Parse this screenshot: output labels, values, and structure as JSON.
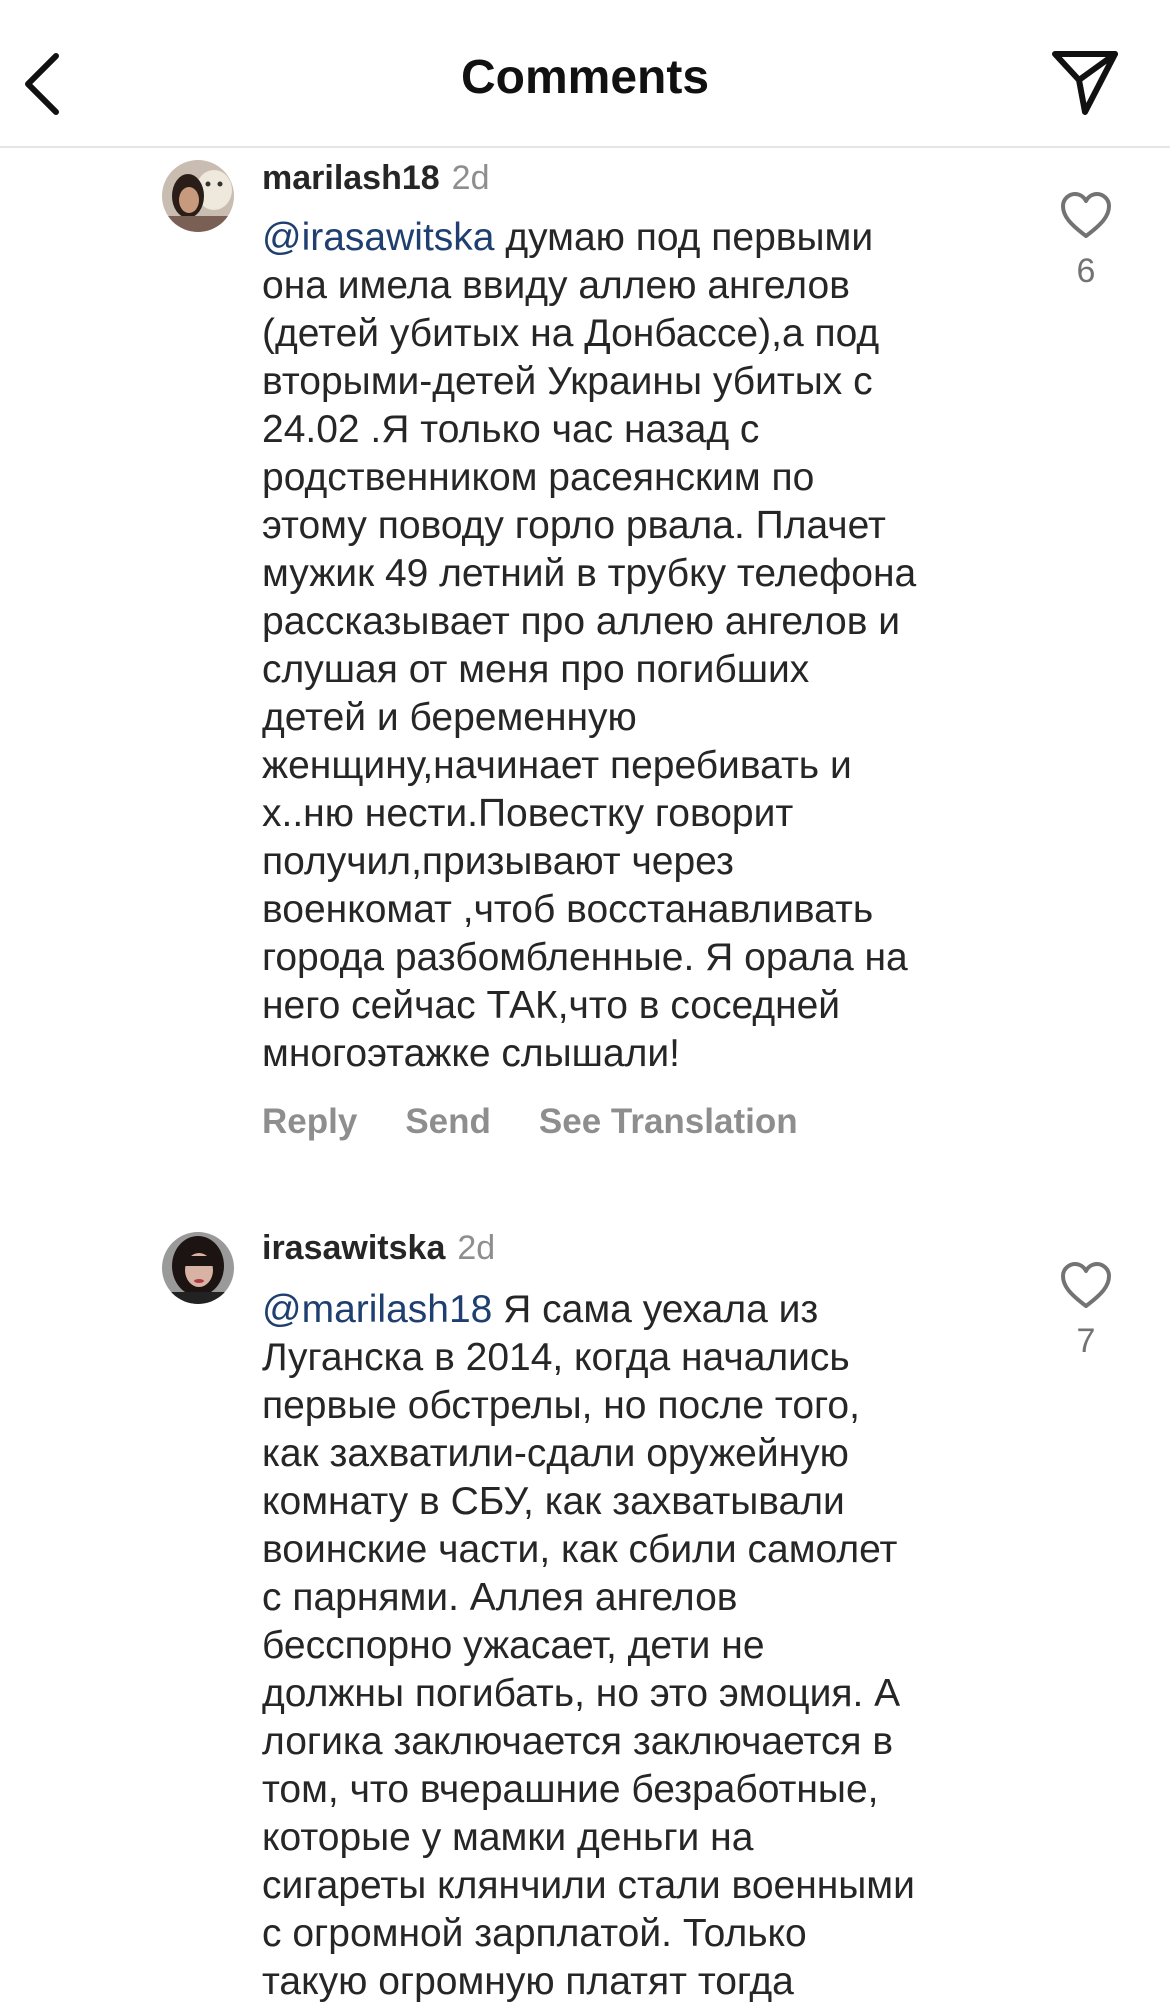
{
  "header": {
    "title": "Comments",
    "back_icon": "chevron-left-icon",
    "send_icon": "paper-plane-icon"
  },
  "comments": [
    {
      "username": "marilash18",
      "time": "2d",
      "mention": "@irasawitska",
      "lines": [
        " думаю под первыми",
        "она имела ввиду аллею ангелов",
        "(детей убитых на Донбассе),а под",
        "вторыми-детей Украины убитых с",
        "24.02 .Я только час назад с",
        "родственником расеянским по",
        "этому поводу горло рвала. Плачет",
        "мужик 49 летний в трубку телефона",
        "рассказывает про аллею ангелов и",
        "слушая от меня про погибших",
        "детей и беременную",
        "женщину,начинает перебивать и",
        "х..ню нести.Повестку говорит",
        "получил,призывают через",
        "военкомат ,чтоб восстанавливать",
        "города разбомбленные. Я орала на",
        "него сейчас ТАК,что в соседней",
        "многоэтажке слышали!"
      ],
      "likes": "6",
      "actions": {
        "reply": "Reply",
        "send": "Send",
        "translate": "See Translation"
      }
    },
    {
      "username": "irasawitska",
      "time": "2d",
      "mention": "@marilash18",
      "lines": [
        " Я сама уехала из",
        "Луганска в 2014, когда начались",
        "первые обстрелы, но после того,",
        "как захватили-сдали оружейную",
        "комнату в СБУ, как захватывали",
        "воинские части, как сбили самолет",
        "с парнями. Аллея ангелов",
        "бесспорно ужасает, дети не",
        "должны погибать, но это эмоция. А",
        "логика заключается заключается в",
        "том, что вчерашние безработные,",
        "которые у мамки деньги на",
        "сигареты клянчили стали военными",
        "с  огромной зарплатой. Только",
        "такую огромную платят тогда"
      ],
      "likes": "7"
    }
  ],
  "colors": {
    "mention": "#1f3f70",
    "secondary_text": "#8e8e8e",
    "divider": "#e6e6e6"
  }
}
